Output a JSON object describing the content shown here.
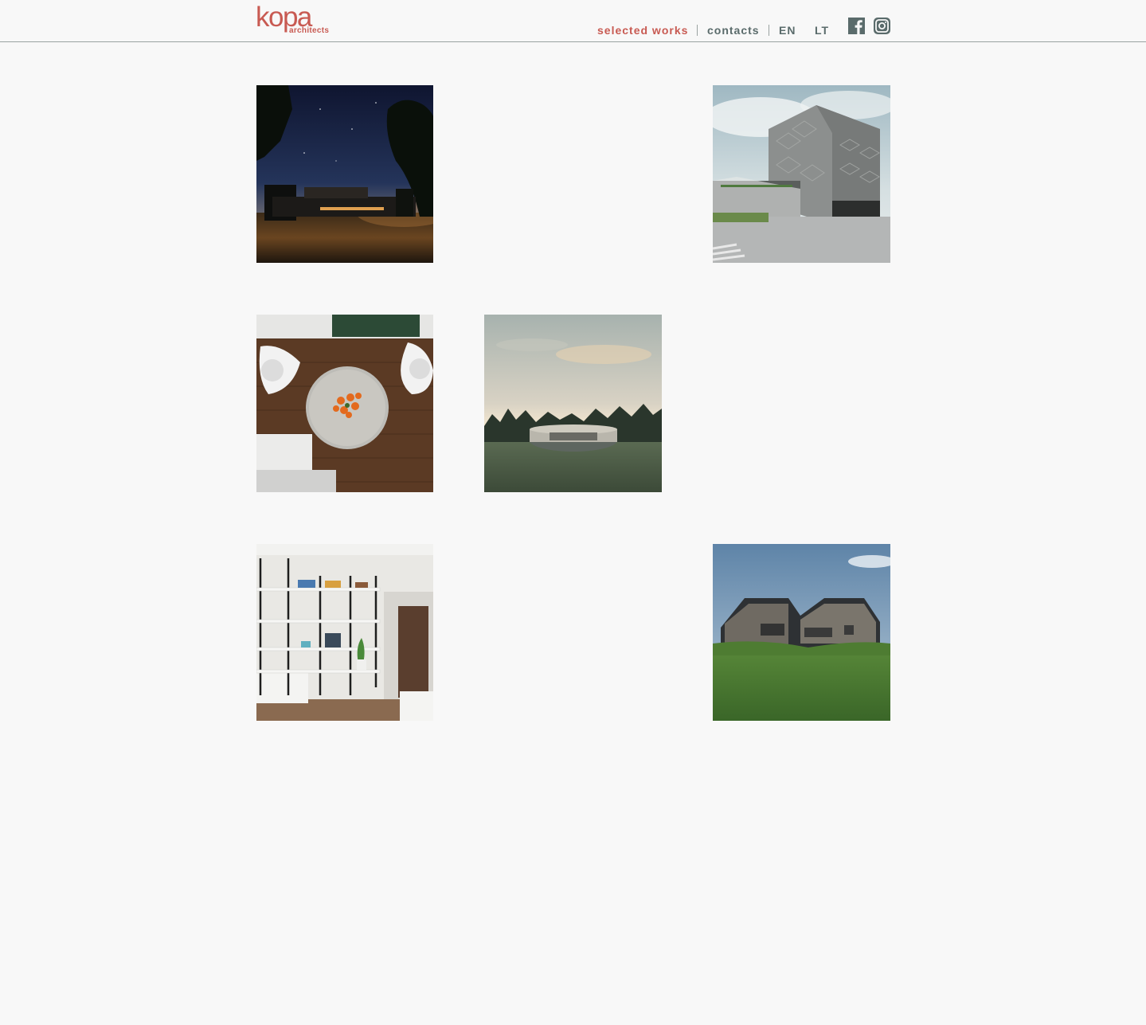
{
  "logo": {
    "word": "kopa",
    "sub": "architects"
  },
  "nav": {
    "selected_works": "selected works",
    "contacts": "contacts",
    "lang_en": "EN",
    "lang_lt": "LT"
  },
  "social": [
    {
      "icon": "facebook-icon"
    },
    {
      "icon": "instagram-icon"
    }
  ],
  "colors": {
    "accent": "#c85a52",
    "nav_text": "#5a6b6b",
    "background": "#f8f8f8",
    "divider": "#9aa3a1"
  },
  "works": [
    {
      "image": "night house render"
    },
    {
      "image": "office building render"
    },
    {
      "image": "dining table interior"
    },
    {
      "image": "circular pavilion render"
    },
    {
      "image": "shelving interior"
    },
    {
      "image": "countryside house render"
    }
  ]
}
